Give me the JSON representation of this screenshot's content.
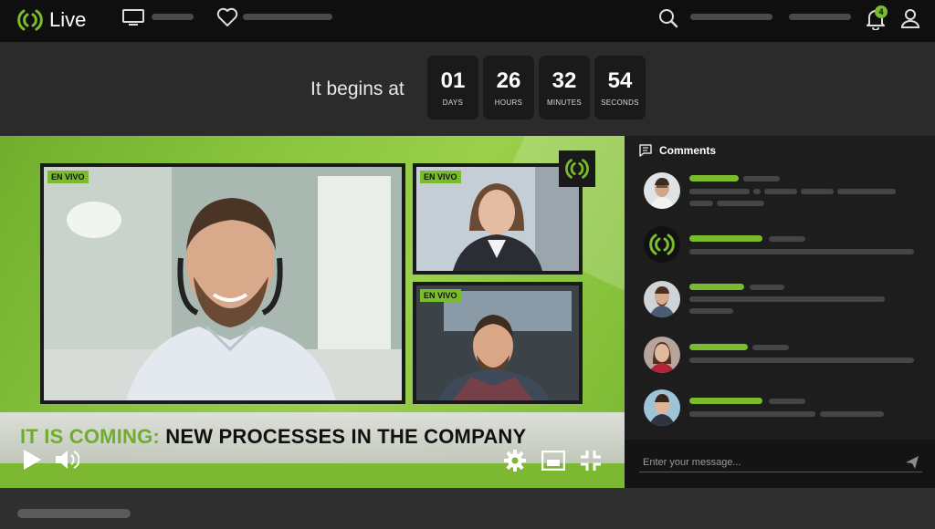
{
  "app": {
    "name": "Live",
    "notification_count": "4"
  },
  "countdown": {
    "intro": "It begins at",
    "units": [
      {
        "value": "01",
        "label": "DAYS"
      },
      {
        "value": "26",
        "label": "HOURS"
      },
      {
        "value": "32",
        "label": "MINUTES"
      },
      {
        "value": "54",
        "label": "SECONDS"
      }
    ]
  },
  "video": {
    "tags": [
      "EN VIVO",
      "EN VIVO",
      "EN VIVO"
    ],
    "caption_highlight": "IT IS COMING:",
    "caption_rest": "NEW PROCESSES IN THE COMPANY"
  },
  "comments": {
    "title": "Comments",
    "placeholder": "Enter your message..."
  },
  "colors": {
    "accent": "#7bbb2e",
    "topbar": "#0f0f0f",
    "sidebar": "#1d1d1d"
  },
  "icons": [
    "live-logo-icon",
    "tv-icon",
    "heart-icon",
    "search-icon",
    "bell-icon",
    "user-icon",
    "comment-icon",
    "play-icon",
    "volume-icon",
    "settings-icon",
    "miniplayer-icon",
    "exit-fullscreen-icon",
    "send-icon"
  ]
}
